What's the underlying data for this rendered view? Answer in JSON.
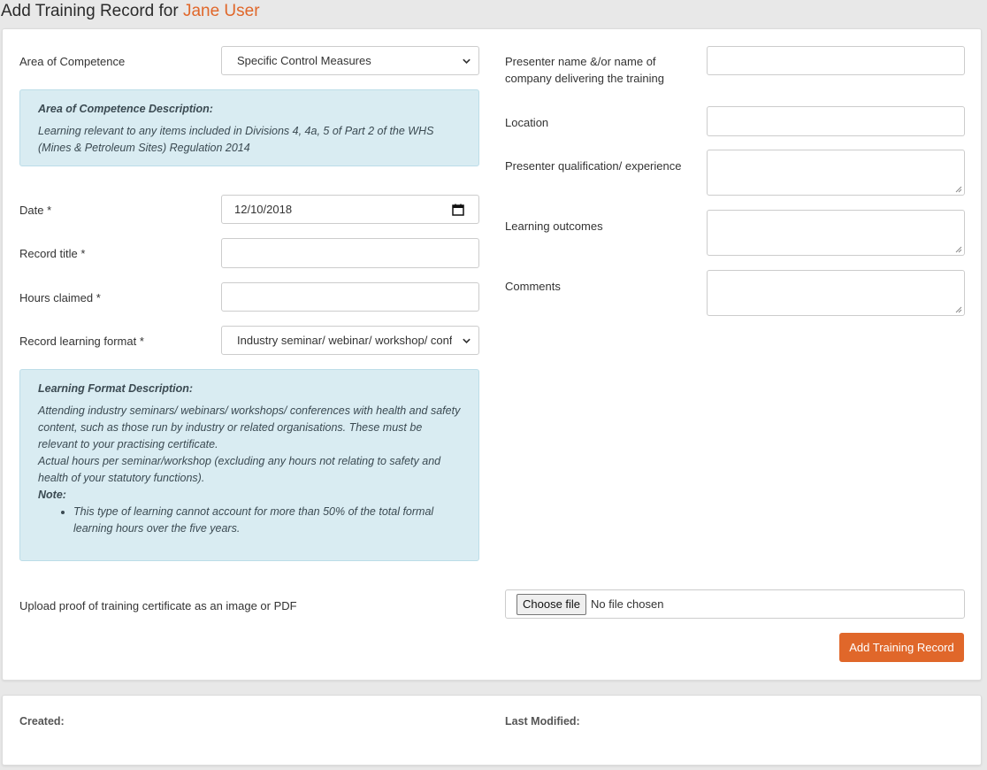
{
  "page": {
    "title_prefix": "Add Training Record for ",
    "user_name": "Jane User"
  },
  "colors": {
    "accent": "#e0672a",
    "info_bg": "#d9ecf2"
  },
  "form": {
    "area_of_competence": {
      "label": "Area of Competence",
      "selected": "Specific Control Measures"
    },
    "competence_description": {
      "title": "Area of Competence Description:",
      "text": "Learning relevant to any items included in Divisions 4, 4a, 5 of Part 2 of the WHS (Mines & Petroleum Sites) Regulation 2014"
    },
    "date": {
      "label": "Date *",
      "value": "12/10/2018"
    },
    "record_title": {
      "label": "Record title *",
      "value": ""
    },
    "hours_claimed": {
      "label": "Hours claimed *",
      "value": ""
    },
    "learning_format": {
      "label": "Record learning format *",
      "selected": "Industry seminar/ webinar/ workshop/ conf"
    },
    "format_description": {
      "title": "Learning Format Description:",
      "para1": "Attending industry seminars/ webinars/ workshops/ conferences with health and safety content, such as those run by industry or related organisations. These must be relevant to your practising certificate.",
      "para2": "Actual hours per seminar/workshop (excluding any hours not relating to safety and health of your statutory functions).",
      "note_label": "Note:",
      "note_item": "This type of learning cannot account for more than 50% of the total formal learning hours over the five years."
    },
    "presenter_name": {
      "label": "Presenter name &/or name of company delivering the training",
      "value": ""
    },
    "location": {
      "label": "Location",
      "value": ""
    },
    "presenter_qualification": {
      "label": "Presenter qualification/ experience",
      "value": ""
    },
    "learning_outcomes": {
      "label": "Learning outcomes",
      "value": ""
    },
    "comments": {
      "label": "Comments",
      "value": ""
    },
    "upload": {
      "label": "Upload proof of training certificate as an image or PDF",
      "button": "Choose file",
      "status": "No file chosen"
    },
    "submit_label": "Add Training Record"
  },
  "meta": {
    "created_label": "Created:",
    "modified_label": "Last Modified:"
  }
}
